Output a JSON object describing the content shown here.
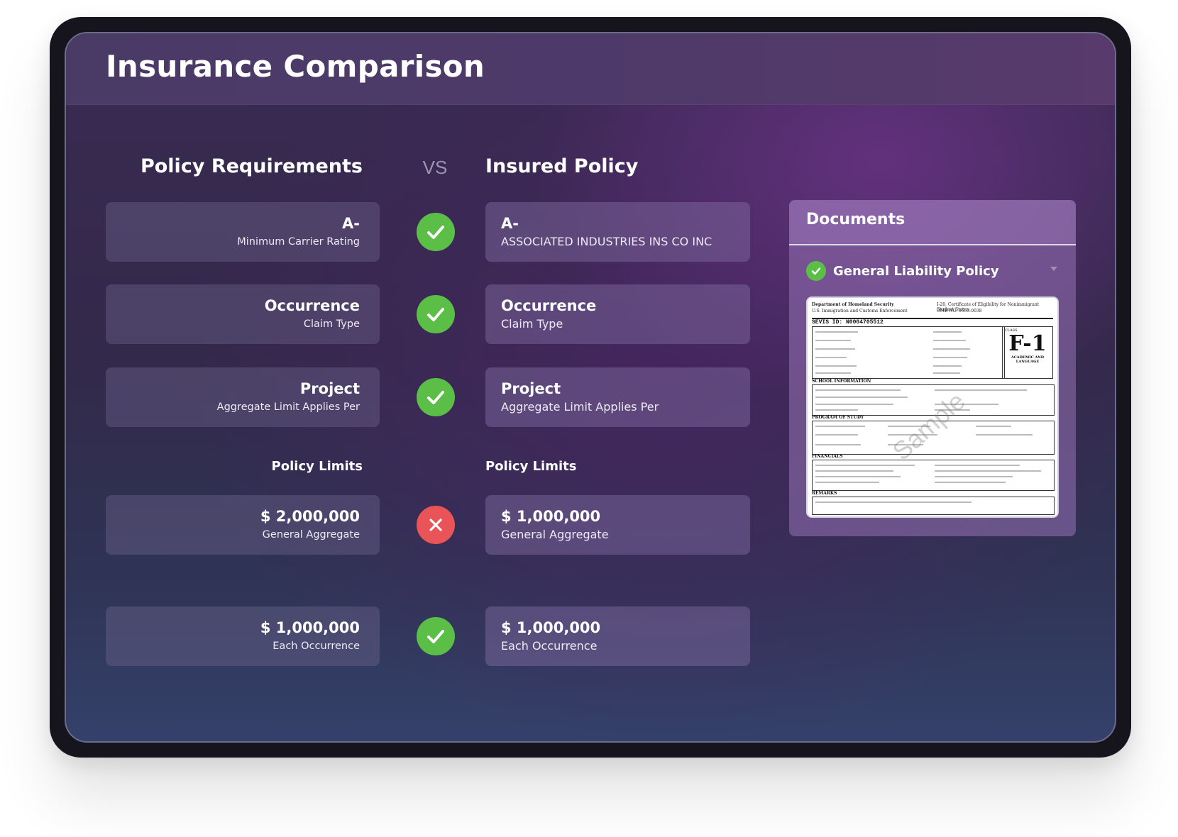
{
  "header": {
    "title": "Insurance Comparison"
  },
  "columns": {
    "requirements": "Policy Requirements",
    "vs": "VS",
    "insured": "Insured Policy"
  },
  "rows": [
    {
      "req_main": "A-",
      "req_sub": "Minimum Carrier Rating",
      "status": "match",
      "ins_main": "A-",
      "ins_sub": "ASSOCIATED INDUSTRIES INS CO INC"
    },
    {
      "req_main": "Occurrence",
      "req_sub": "Claim Type",
      "status": "match",
      "ins_main": "Occurrence",
      "ins_sub": "Claim Type"
    },
    {
      "req_main": "Project",
      "req_sub": "Aggregate Limit Applies Per",
      "status": "match",
      "ins_main": "Project",
      "ins_sub": "Aggregate Limit Applies Per"
    }
  ],
  "limits": {
    "left_label": "Policy Limits",
    "right_label": "Policy Limits",
    "rows": [
      {
        "req_main": "$ 2,000,000",
        "req_sub": "General Aggregate",
        "status": "mismatch",
        "ins_main": "$ 1,000,000",
        "ins_sub": "General Aggregate"
      },
      {
        "req_main": "$ 1,000,000",
        "req_sub": "Each Occurrence",
        "status": "match",
        "ins_main": "$ 1,000,000",
        "ins_sub": "Each Occurrence"
      }
    ]
  },
  "documents": {
    "title": "Documents",
    "items": [
      {
        "name": "General Liability Policy",
        "status": "verified"
      }
    ],
    "preview": {
      "agency": "Department of Homeland Security",
      "subagency": "U.S. Immigration and Customs Enforcement",
      "form_title": "I-20, Certificate of Eligibility for Nonimmigrant Student Status",
      "omb": "OMB NO. 1653-0038",
      "sevis_id": "SEVIS ID:  N0004705512",
      "class_label": "CLASS",
      "class_value": "F-1",
      "class_desc": "ACADEMIC AND LANGUAGE",
      "sections": [
        "SCHOOL INFORMATION",
        "PROGRAM OF STUDY",
        "FINANCIALS",
        "REMARKS"
      ],
      "watermark": "Sample"
    }
  },
  "colors": {
    "ok": "#5bbf47",
    "fail": "#e85457"
  },
  "icons": {
    "ok": "check-icon",
    "fail": "x-icon"
  }
}
